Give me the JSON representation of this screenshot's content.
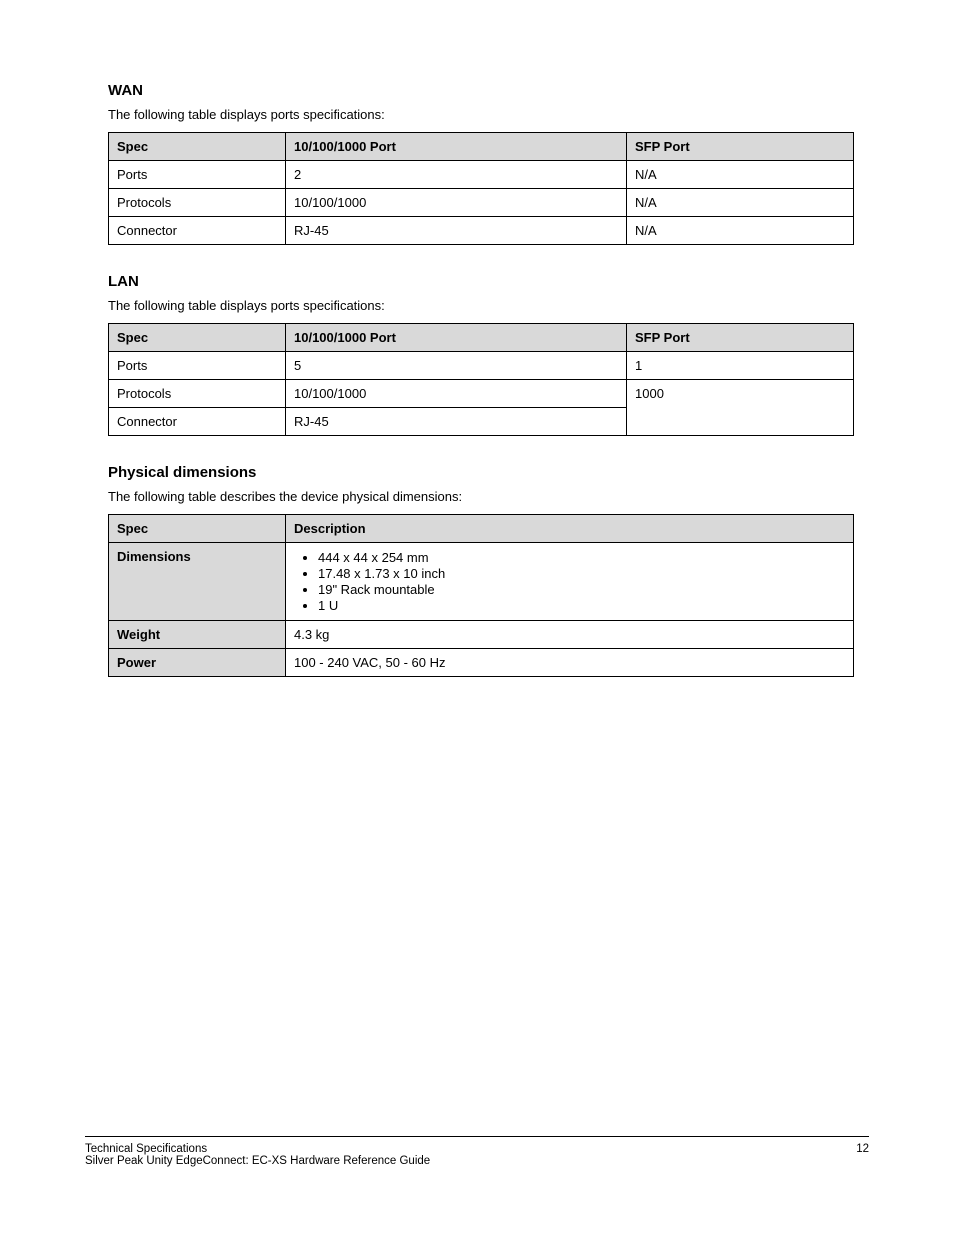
{
  "sections": {
    "wan": {
      "heading": "WAN",
      "subtext": "The following table displays ports specifications:",
      "headers": [
        "Spec",
        "10/100/1000 Port",
        "SFP Port"
      ],
      "rows": [
        [
          "Ports",
          "2",
          "N/A"
        ],
        [
          "Protocols",
          "10/100/1000",
          "N/A"
        ],
        [
          "Connector",
          "RJ-45",
          "N/A"
        ]
      ]
    },
    "lan": {
      "heading": "LAN",
      "subtext": "The following table displays ports specifications:",
      "headers": [
        "Spec",
        "10/100/1000 Port",
        "SFP Port"
      ],
      "rows": [
        [
          "Ports",
          "5",
          "1"
        ],
        [
          "Protocols",
          "10/100/1000",
          "1000"
        ],
        [
          "Connector",
          "RJ-45",
          ""
        ]
      ]
    },
    "physical": {
      "heading": "Physical dimensions",
      "subtext": "The following table describes the device physical dimensions:",
      "headers": [
        "Spec",
        "Description"
      ],
      "rows": {
        "dimensions": {
          "label": "Dimensions",
          "items": [
            "444 x 44 x 254 mm",
            "17.48 x 1.73 x 10 inch",
            "19\" Rack mountable",
            "1 U"
          ]
        },
        "weight": {
          "label": "Weight",
          "value": "4.3 kg"
        },
        "power": {
          "label": "Power",
          "value": "100 - 240 VAC, 50 - 60 Hz"
        }
      }
    }
  },
  "footer": {
    "left_title": "Technical Specifications",
    "left_sub": "Silver Peak Unity EdgeConnect: EC-XS Hardware Reference Guide",
    "page_number": "12"
  }
}
